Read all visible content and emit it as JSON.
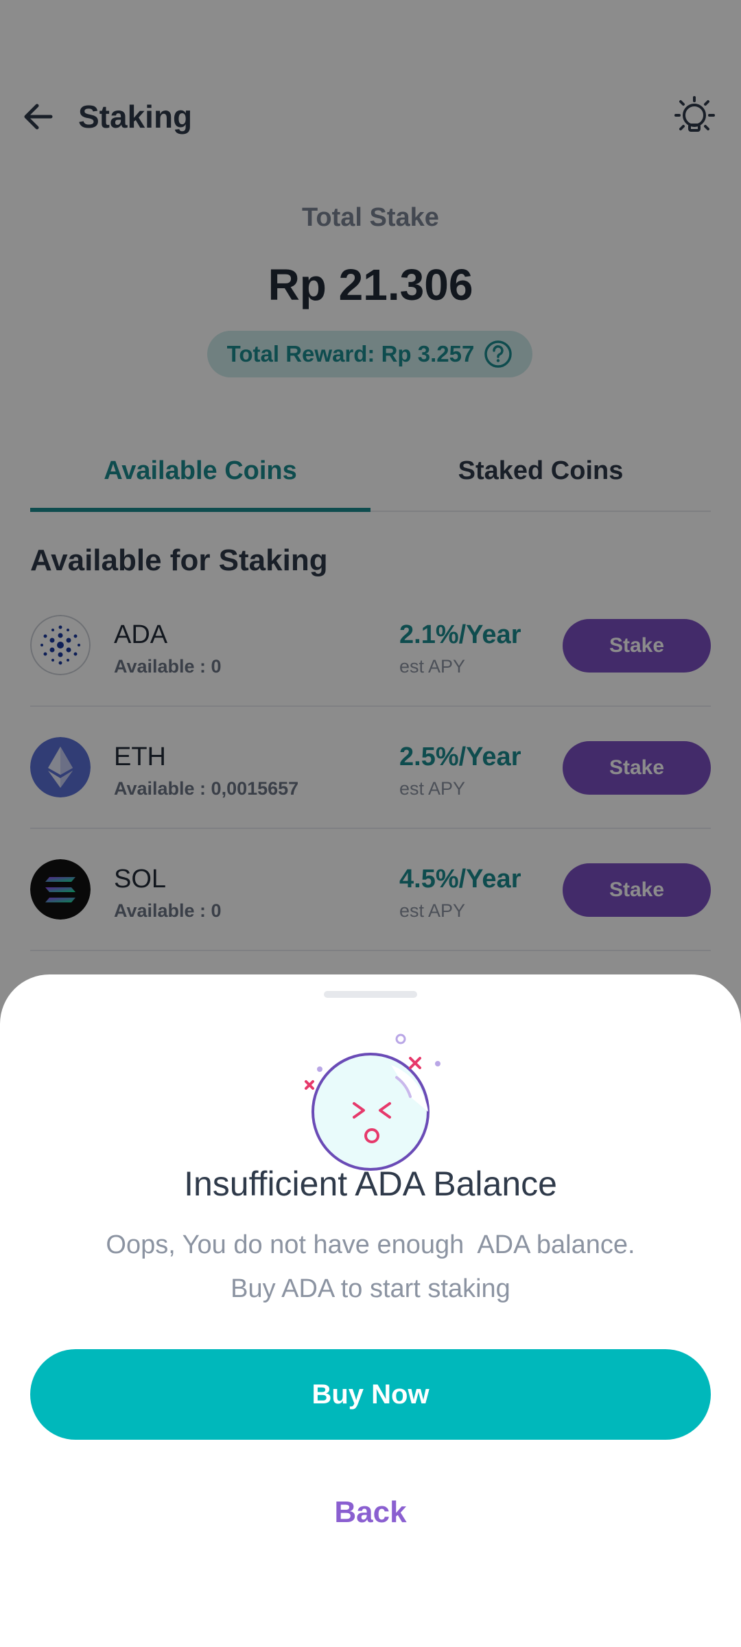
{
  "header": {
    "title": "Staking",
    "back_icon": "back-arrow-icon",
    "tips_icon": "lightbulb-icon"
  },
  "summary": {
    "total_label": "Total Stake",
    "total_value": "Rp 21.306",
    "reward_text": "Total Reward: Rp 3.257",
    "help_icon": "question-circle-icon"
  },
  "tabs": [
    {
      "label": "Available Coins",
      "active": true
    },
    {
      "label": "Staked Coins",
      "active": false
    }
  ],
  "section_title": "Available for Staking",
  "coins": [
    {
      "name": "ADA",
      "available": "Available : 0",
      "apy": "2.1%/Year",
      "apy_label": "est APY",
      "button": "Stake",
      "icon": "cardano-icon"
    },
    {
      "name": "ETH",
      "available": "Available : 0,0015657",
      "apy": "2.5%/Year",
      "apy_label": "est APY",
      "button": "Stake",
      "icon": "ethereum-icon"
    },
    {
      "name": "SOL",
      "available": "Available : 0",
      "apy": "4.5%/Year",
      "apy_label": "est APY",
      "button": "Stake",
      "icon": "solana-icon"
    }
  ],
  "sheet": {
    "title": "Insufficient ADA Balance",
    "message_line1": "Oops, You do not have enough  ADA balance.",
    "message_line2": "Buy ADA to start staking",
    "primary_button": "Buy Now",
    "secondary_button": "Back"
  },
  "colors": {
    "accent_teal": "#00b8bb",
    "tab_teal": "#1b8a8e",
    "stake_purple": "#7a4fc2",
    "back_purple": "#8a5fd0",
    "overlay": "rgba(0,0,0,0.45)"
  }
}
